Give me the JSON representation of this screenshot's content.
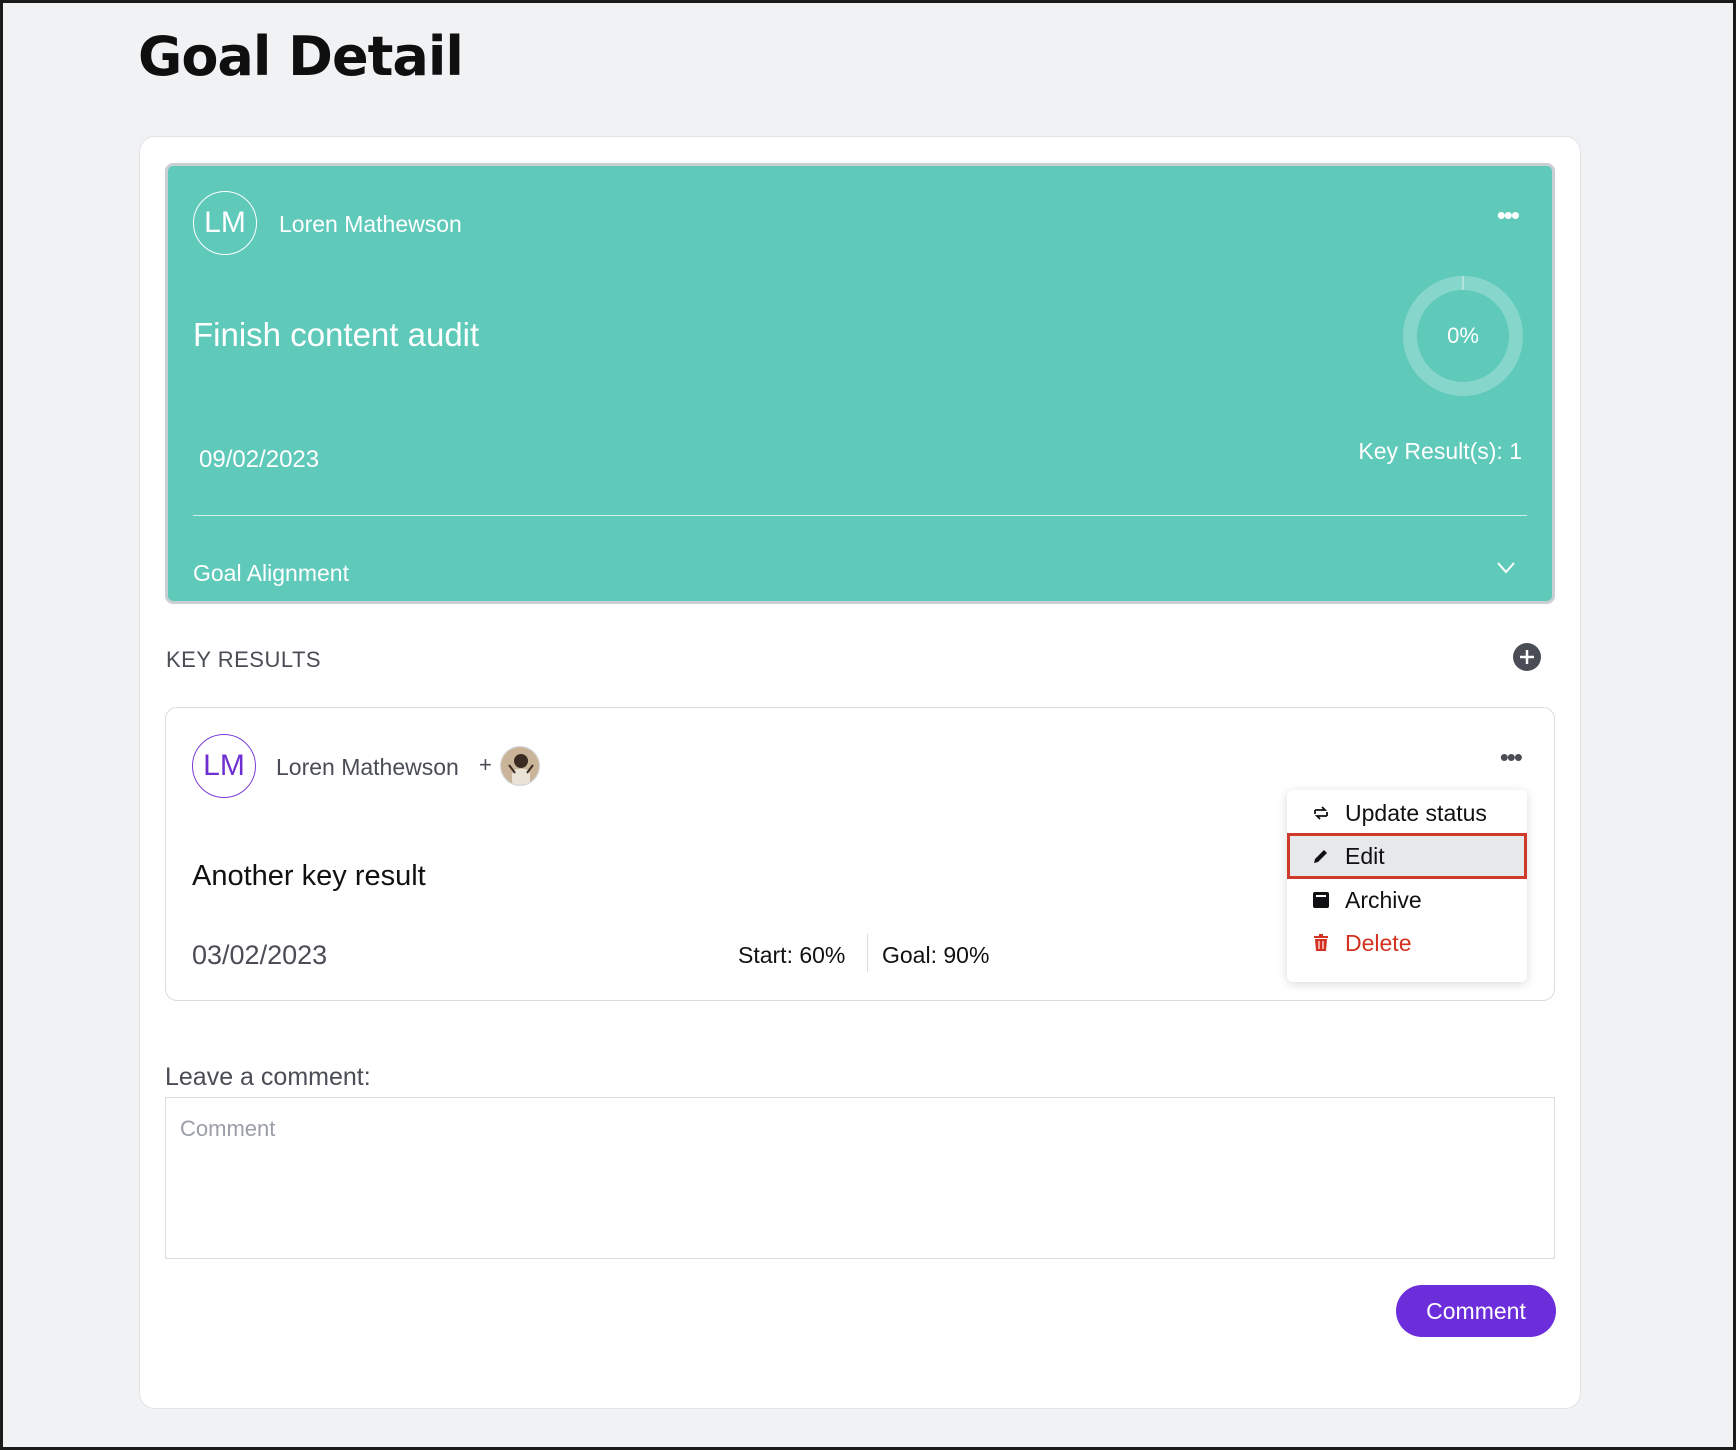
{
  "page": {
    "title": "Goal Detail"
  },
  "goal": {
    "owner_initials": "LM",
    "owner_name": "Loren Mathewson",
    "title": "Finish content audit",
    "progress_label": "0%",
    "progress_percent": 0,
    "date": "09/02/2023",
    "key_results_count": "Key Result(s): 1",
    "alignment_label": "Goal Alignment",
    "more_label": "•••"
  },
  "key_results": {
    "heading": "KEY RESULTS",
    "items": [
      {
        "owner_initials": "LM",
        "owner_name": "Loren Mathewson",
        "plus": "+",
        "title": "Another key result",
        "date": "03/02/2023",
        "start": "Start: 60%",
        "goal": "Goal: 90%",
        "more_label": "•••"
      }
    ]
  },
  "context_menu": {
    "items": [
      {
        "label": "Update status",
        "icon": "refresh-icon"
      },
      {
        "label": "Edit",
        "icon": "pencil-icon",
        "selected": true
      },
      {
        "label": "Archive",
        "icon": "archive-icon"
      },
      {
        "label": "Delete",
        "icon": "trash-icon",
        "danger": true
      }
    ]
  },
  "comment": {
    "label": "Leave a comment:",
    "placeholder": "Comment",
    "value": "",
    "button_label": "Comment"
  },
  "colors": {
    "goal_card": "#5fc9ba",
    "accent_purple": "#6c2ddb",
    "danger": "#d2321f",
    "highlight_border": "#cf3b2a"
  }
}
